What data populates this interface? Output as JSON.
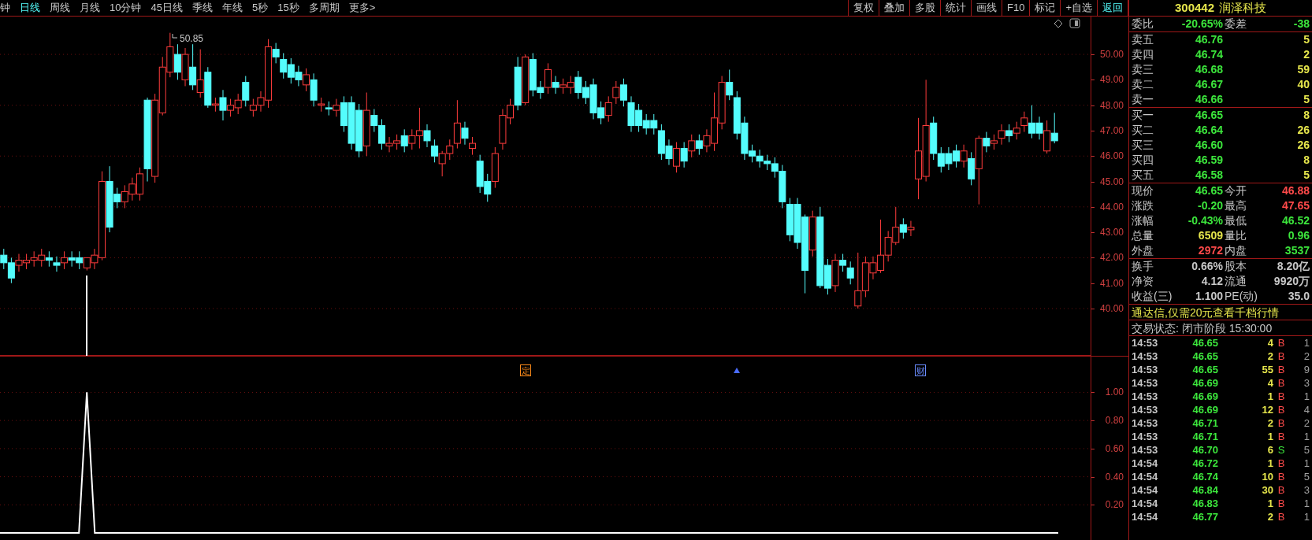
{
  "period_tabs": [
    {
      "label": "钟",
      "selected": false
    },
    {
      "label": "日线",
      "selected": true
    },
    {
      "label": "周线",
      "selected": false
    },
    {
      "label": "月线",
      "selected": false
    },
    {
      "label": "10分钟",
      "selected": false
    },
    {
      "label": "45日线",
      "selected": false
    },
    {
      "label": "季线",
      "selected": false
    },
    {
      "label": "年线",
      "selected": false
    },
    {
      "label": "5秒",
      "selected": false
    },
    {
      "label": "15秒",
      "selected": false
    },
    {
      "label": "多周期",
      "selected": false
    },
    {
      "label": "更多>",
      "selected": false
    }
  ],
  "toolbar": [
    {
      "label": "复权",
      "selected": false
    },
    {
      "label": "叠加",
      "selected": false
    },
    {
      "label": "多股",
      "selected": false
    },
    {
      "label": "统计",
      "selected": false
    },
    {
      "label": "画线",
      "selected": false
    },
    {
      "label": "F10",
      "selected": false
    },
    {
      "label": "标记",
      "selected": false
    },
    {
      "label": "+自选",
      "selected": false
    },
    {
      "label": "返回",
      "selected": true
    }
  ],
  "price_chart": {
    "high_label": "50.85",
    "chart_data": {
      "type": "candlestick",
      "grid": true,
      "ylim": [
        38.14,
        51.49
      ],
      "yticks": [
        {
          "value": 50,
          "label": "50.00"
        },
        {
          "value": 49,
          "label": "49.00"
        },
        {
          "value": 48,
          "label": "48.00"
        },
        {
          "value": 47,
          "label": "47.00"
        },
        {
          "value": 46,
          "label": "46.00"
        },
        {
          "value": 45,
          "label": "45.00"
        },
        {
          "value": 44,
          "label": "44.00"
        },
        {
          "value": 43,
          "label": "43.00"
        },
        {
          "value": 42,
          "label": "42.00"
        },
        {
          "value": 41,
          "label": "41.00"
        },
        {
          "value": 40,
          "label": "40.00"
        }
      ],
      "categories": [
        null,
        null,
        null,
        null,
        null,
        null,
        null,
        null,
        null,
        null,
        null,
        null,
        null,
        null,
        null,
        null,
        null,
        null,
        null,
        null,
        null,
        null,
        null,
        null,
        null,
        null,
        null,
        null,
        null,
        null,
        null,
        null,
        null,
        null,
        null,
        null,
        null,
        null,
        null,
        null,
        null,
        null,
        null,
        null,
        null,
        null,
        null,
        null,
        null,
        null,
        null,
        null,
        null,
        null,
        null,
        null,
        null,
        null,
        null,
        null,
        null,
        null,
        null,
        null,
        null,
        null,
        null,
        null,
        null,
        null,
        null,
        null,
        null,
        null,
        null,
        null,
        null,
        null,
        null,
        null,
        null,
        null,
        null,
        null,
        null,
        null,
        null,
        null,
        null,
        null,
        null,
        null,
        null,
        null,
        null,
        null,
        null,
        null,
        null,
        null,
        null,
        null,
        null,
        null,
        null,
        null,
        null,
        null,
        null,
        null,
        null,
        null,
        null,
        null,
        null,
        null,
        null,
        null,
        null,
        null,
        null,
        null,
        null,
        null,
        null,
        null,
        null,
        null,
        null,
        null,
        null,
        null,
        null,
        null,
        null,
        null,
        null,
        null,
        null,
        null
      ],
      "ohlc": [
        [
          42.1,
          42.35,
          41.55,
          41.8
        ],
        [
          41.8,
          42,
          41,
          41.2
        ],
        [
          41.7,
          42.15,
          41.45,
          41.9
        ],
        [
          41.8,
          42.15,
          41.55,
          41.9
        ],
        [
          41.9,
          42.25,
          41.65,
          42
        ],
        [
          41.9,
          42.35,
          41.65,
          42.1
        ],
        [
          42,
          42.25,
          41.65,
          41.9
        ],
        [
          41.8,
          42.05,
          41.45,
          41.7
        ],
        [
          41.8,
          42.25,
          41.55,
          42
        ],
        [
          42,
          42.25,
          41.65,
          41.9
        ],
        [
          42,
          42.25,
          41.55,
          41.8
        ],
        [
          41.6,
          42,
          41.5,
          42
        ],
        [
          41.8,
          42.35,
          41.55,
          42.1
        ],
        [
          42,
          45.4,
          41.9,
          45
        ],
        [
          45,
          45.6,
          43,
          43.2
        ],
        [
          44.5,
          44.75,
          43.95,
          44.2
        ],
        [
          44.2,
          44.85,
          43.95,
          44.6
        ],
        [
          44.5,
          45.15,
          44.25,
          44.9
        ],
        [
          44.5,
          45.55,
          44.25,
          45.3
        ],
        [
          48.2,
          48.3,
          45,
          45.5
        ],
        [
          45.2,
          48.45,
          44.95,
          48.2
        ],
        [
          47.7,
          49.9,
          47.6,
          49.5
        ],
        [
          49.3,
          50.85,
          49.1,
          50.3
        ],
        [
          50,
          50.4,
          49,
          49.3
        ],
        [
          49,
          50.25,
          48.75,
          50
        ],
        [
          49.5,
          50.4,
          48.6,
          48.8
        ],
        [
          48.5,
          50.2,
          48.3,
          49
        ],
        [
          49.3,
          49.5,
          47.9,
          48
        ],
        [
          48,
          48.3,
          47.75,
          48.05
        ],
        [
          48.3,
          48.6,
          47.4,
          47.8
        ],
        [
          47.8,
          48.25,
          47.55,
          48
        ],
        [
          47.9,
          48.45,
          47.65,
          48.2
        ],
        [
          48.9,
          49.15,
          47.95,
          48.2
        ],
        [
          47.8,
          48.25,
          47.55,
          48
        ],
        [
          48,
          48.55,
          47.75,
          48.3
        ],
        [
          48.2,
          50.6,
          47.9,
          50.3
        ],
        [
          50.2,
          50.45,
          49.65,
          49.9
        ],
        [
          49.8,
          50.05,
          49.05,
          49.3
        ],
        [
          49.6,
          49.85,
          48.85,
          49.1
        ],
        [
          49.3,
          49.55,
          48.75,
          49
        ],
        [
          48.8,
          49.45,
          48.55,
          49.2
        ],
        [
          49,
          49.25,
          47.95,
          48.2
        ],
        [
          48,
          48.3,
          47.75,
          48.05
        ],
        [
          47.9,
          48.15,
          47.6,
          47.85
        ],
        [
          47.8,
          48.25,
          47.55,
          48
        ],
        [
          48.1,
          48.35,
          46.95,
          47.2
        ],
        [
          48.1,
          48.35,
          46.25,
          46.5
        ],
        [
          47.8,
          48.05,
          45.95,
          46.2
        ],
        [
          46.4,
          48.5,
          46,
          47.8
        ],
        [
          47.6,
          47.85,
          46.95,
          47.2
        ],
        [
          47.2,
          47.45,
          46.25,
          46.5
        ],
        [
          46.4,
          46.75,
          46.15,
          46.5
        ],
        [
          46.5,
          46.85,
          46.25,
          46.6
        ],
        [
          46.8,
          47.05,
          46.15,
          46.4
        ],
        [
          46.5,
          47.05,
          46.25,
          46.8
        ],
        [
          46.8,
          47.9,
          46.3,
          47
        ],
        [
          47,
          47.25,
          46.35,
          46.6
        ],
        [
          46.4,
          46.65,
          45.75,
          46
        ],
        [
          45.7,
          46.2,
          45.2,
          46.1
        ],
        [
          46.1,
          46.65,
          45.85,
          46.4
        ],
        [
          46.5,
          48.2,
          46.3,
          47.3
        ],
        [
          47.1,
          47.35,
          46.45,
          46.7
        ],
        [
          46.3,
          46.75,
          46.05,
          46.5
        ],
        [
          45.8,
          46.05,
          44.55,
          44.8
        ],
        [
          45,
          45.3,
          44.2,
          44.5
        ],
        [
          45,
          46.35,
          44.75,
          46.1
        ],
        [
          46.5,
          47.85,
          46.25,
          47.6
        ],
        [
          47.5,
          48.25,
          47.25,
          48
        ],
        [
          49.5,
          49.9,
          47.8,
          48
        ],
        [
          48.1,
          50,
          48,
          49.9
        ],
        [
          49.8,
          50.05,
          48.35,
          48.6
        ],
        [
          48.7,
          48.95,
          48.25,
          48.5
        ],
        [
          48.7,
          49.65,
          48.45,
          49.4
        ],
        [
          48.9,
          49.15,
          48.45,
          48.7
        ],
        [
          48.7,
          49.05,
          48.45,
          48.8
        ],
        [
          48.7,
          49.15,
          48.45,
          48.9
        ],
        [
          49.1,
          49.35,
          48.25,
          48.5
        ],
        [
          48.7,
          48.95,
          48.05,
          48.3
        ],
        [
          48.8,
          49.05,
          47.45,
          47.7
        ],
        [
          47.9,
          48.15,
          47.25,
          47.5
        ],
        [
          47.6,
          48.35,
          47.35,
          48.1
        ],
        [
          48.3,
          48.95,
          48.05,
          48.7
        ],
        [
          48.8,
          49.05,
          47.95,
          48.2
        ],
        [
          48.1,
          48.35,
          46.95,
          47.2
        ],
        [
          47.8,
          48.05,
          46.95,
          47.2
        ],
        [
          47.4,
          47.65,
          46.85,
          47.1
        ],
        [
          47.4,
          47.65,
          46.85,
          47.1
        ],
        [
          47,
          47.25,
          45.85,
          46.1
        ],
        [
          46.4,
          46.65,
          45.65,
          45.9
        ],
        [
          45.6,
          46.55,
          45.35,
          46.3
        ],
        [
          46.3,
          46.55,
          45.55,
          45.8
        ],
        [
          46.2,
          46.85,
          45.95,
          46.6
        ],
        [
          46.6,
          46.85,
          46.05,
          46.3
        ],
        [
          46.4,
          47.05,
          46.15,
          46.8
        ],
        [
          46.5,
          48.5,
          46.2,
          47.5
        ],
        [
          47.3,
          49.15,
          47.05,
          48.9
        ],
        [
          48.9,
          49.4,
          48.2,
          48.4
        ],
        [
          48.3,
          48.55,
          46.65,
          46.9
        ],
        [
          47.3,
          47.55,
          45.85,
          46.1
        ],
        [
          46.2,
          46.45,
          45.75,
          46
        ],
        [
          46,
          46.25,
          45.55,
          45.8
        ],
        [
          45.8,
          46.05,
          45.45,
          45.7
        ],
        [
          45.7,
          45.95,
          45.15,
          45.4
        ],
        [
          45.4,
          45.65,
          43.95,
          44.2
        ],
        [
          44.1,
          44.35,
          42.65,
          42.9
        ],
        [
          44.1,
          44.35,
          42.35,
          42.6
        ],
        [
          43.6,
          43.7,
          40.6,
          41.5
        ],
        [
          42.3,
          43.85,
          42.05,
          43.6
        ],
        [
          43.6,
          44,
          40.8,
          40.9
        ],
        [
          41.7,
          41.95,
          40.55,
          40.8
        ],
        [
          40.9,
          42.15,
          40.65,
          41.9
        ],
        [
          41.9,
          42.15,
          41.45,
          41.7
        ],
        [
          41.6,
          41.85,
          40.95,
          41.2
        ],
        [
          40.1,
          42.2,
          40,
          40.7
        ],
        [
          40.7,
          42.05,
          40.45,
          41.8
        ],
        [
          41.4,
          42.05,
          41.15,
          41.8
        ],
        [
          41.5,
          43.5,
          41.4,
          42.1
        ],
        [
          42.1,
          43.05,
          41.85,
          42.8
        ],
        [
          42.6,
          44,
          42.5,
          43.2
        ],
        [
          43.3,
          43.55,
          42.75,
          43
        ],
        [
          43.1,
          43.45,
          42.85,
          43.2
        ],
        [
          45.1,
          47.5,
          44.3,
          46.2
        ],
        [
          45.2,
          49,
          45,
          47.2
        ],
        [
          47.3,
          47.55,
          45.85,
          46.1
        ],
        [
          46.1,
          46.35,
          45.35,
          45.6
        ],
        [
          46.1,
          46.35,
          45.45,
          45.7
        ],
        [
          46.2,
          46.45,
          45.55,
          45.8
        ],
        [
          45.8,
          46.45,
          45.55,
          46.2
        ],
        [
          45.9,
          46.15,
          44.85,
          45.1
        ],
        [
          45.5,
          46.8,
          44.1,
          46.7
        ],
        [
          46.7,
          46.95,
          46.15,
          46.4
        ],
        [
          46.5,
          46.85,
          46.25,
          46.6
        ],
        [
          46.7,
          47.25,
          46.45,
          47
        ],
        [
          47,
          47.25,
          46.55,
          46.8
        ],
        [
          46.9,
          47.35,
          46.65,
          47.1
        ],
        [
          47.2,
          47.75,
          46.95,
          47.5
        ],
        [
          47.3,
          48,
          46.7,
          46.9
        ],
        [
          47.3,
          47.55,
          46.65,
          46.9
        ],
        [
          46.2,
          47.4,
          46.1,
          47
        ],
        [
          46.9,
          47.7,
          46.5,
          46.6
        ]
      ]
    }
  },
  "indicator_chart": {
    "events": [
      {
        "kind": "badge",
        "label": "定",
        "color": "#ff8c1a"
      },
      {
        "kind": "arrow",
        "color": "#4a6cff"
      },
      {
        "kind": "badge",
        "label": "财",
        "color": "#6a8cff"
      }
    ],
    "chart_data": {
      "type": "line",
      "grid": true,
      "ylim": [
        -0.05,
        1.26
      ],
      "yticks": [
        {
          "value": 0.2,
          "label": "0.20"
        },
        {
          "value": 0.4,
          "label": "0.40"
        },
        {
          "value": 0.6,
          "label": "0.60"
        },
        {
          "value": 0.8,
          "label": "0.80"
        },
        {
          "value": 1.0,
          "label": "1.00"
        }
      ],
      "series": [
        {
          "color": "#ffffff",
          "values": [
            0,
            0,
            0,
            0,
            0,
            0,
            0,
            0,
            0,
            0,
            0,
            1,
            0,
            0,
            0,
            0,
            0,
            0,
            0,
            0,
            0,
            0,
            0,
            0,
            0,
            0,
            0,
            0,
            0,
            0,
            0,
            0,
            0,
            0,
            0,
            0,
            0,
            0,
            0,
            0,
            0,
            0,
            0,
            0,
            0,
            0,
            0,
            0,
            0,
            0,
            0,
            0,
            0,
            0,
            0,
            0,
            0,
            0,
            0,
            0,
            0,
            0,
            0,
            0,
            0,
            0,
            0,
            0,
            0,
            0,
            0,
            0,
            0,
            0,
            0,
            0,
            0,
            0,
            0,
            0,
            0,
            0,
            0,
            0,
            0,
            0,
            0,
            0,
            0,
            0,
            0,
            0,
            0,
            0,
            0,
            0,
            0,
            0,
            0,
            0,
            0,
            0,
            0,
            0,
            0,
            0,
            0,
            0,
            0,
            0,
            0,
            0,
            0,
            0,
            0,
            0,
            0,
            0,
            0,
            0,
            0,
            0,
            0,
            0,
            0,
            0,
            0,
            0,
            0,
            0,
            0,
            0,
            0,
            0,
            0
          ]
        }
      ]
    }
  },
  "quote": {
    "code": "300442",
    "name": "润泽科技",
    "ratio": [
      {
        "label": "委比",
        "value": "-20.65%",
        "color": "#3ce63c"
      },
      {
        "label": "委差",
        "value": "-38",
        "color": "#3ce63c"
      }
    ],
    "asks": [
      {
        "label": "卖五",
        "price": "46.76",
        "volume": "5"
      },
      {
        "label": "卖四",
        "price": "46.74",
        "volume": "2"
      },
      {
        "label": "卖三",
        "price": "46.68",
        "volume": "59"
      },
      {
        "label": "卖二",
        "price": "46.67",
        "volume": "40"
      },
      {
        "label": "卖一",
        "price": "46.66",
        "volume": "5"
      }
    ],
    "bids": [
      {
        "label": "买一",
        "price": "46.65",
        "volume": "8"
      },
      {
        "label": "买二",
        "price": "46.64",
        "volume": "26"
      },
      {
        "label": "买三",
        "price": "46.60",
        "volume": "26"
      },
      {
        "label": "买四",
        "price": "46.59",
        "volume": "8"
      },
      {
        "label": "买五",
        "price": "46.58",
        "volume": "5"
      }
    ],
    "stats": [
      {
        "label": "现价",
        "value": "46.65",
        "color": "#3ce63c"
      },
      {
        "label": "今开",
        "value": "46.88",
        "color": "#ff4a4a"
      },
      {
        "label": "涨跌",
        "value": "-0.20",
        "color": "#3ce63c"
      },
      {
        "label": "最高",
        "value": "47.65",
        "color": "#ff4a4a"
      },
      {
        "label": "涨幅",
        "value": "-0.43%",
        "color": "#3ce63c"
      },
      {
        "label": "最低",
        "value": "46.52",
        "color": "#3ce63c"
      },
      {
        "label": "总量",
        "value": "6509",
        "color": "#e6e64c"
      },
      {
        "label": "量比",
        "value": "0.96",
        "color": "#3ce63c"
      },
      {
        "label": "外盘",
        "value": "2972",
        "color": "#ff4a4a"
      },
      {
        "label": "内盘",
        "value": "3537",
        "color": "#3ce63c"
      }
    ],
    "fundamentals": [
      {
        "label": "换手",
        "value": "0.66%"
      },
      {
        "label": "股本",
        "value": "8.20亿"
      },
      {
        "label": "净资",
        "value": "4.12"
      },
      {
        "label": "流通",
        "value": "9920万"
      },
      {
        "label": "收益(三)",
        "value": "1.100"
      },
      {
        "label": "PE(动)",
        "value": "35.0"
      }
    ],
    "promo": "通达信,仅需20元查看千档行情",
    "trade_status": "交易状态: 闭市阶段 15:30:00",
    "ticks": [
      {
        "time": "14:53",
        "price": "46.65",
        "volume": "4",
        "side": "B",
        "color": "#ff4a4a",
        "count": "1"
      },
      {
        "time": "14:53",
        "price": "46.65",
        "volume": "2",
        "side": "B",
        "color": "#ff4a4a",
        "count": "2"
      },
      {
        "time": "14:53",
        "price": "46.65",
        "volume": "55",
        "side": "B",
        "color": "#ff4a4a",
        "count": "9"
      },
      {
        "time": "14:53",
        "price": "46.69",
        "volume": "4",
        "side": "B",
        "color": "#ff4a4a",
        "count": "3"
      },
      {
        "time": "14:53",
        "price": "46.69",
        "volume": "1",
        "side": "B",
        "color": "#ff4a4a",
        "count": "1"
      },
      {
        "time": "14:53",
        "price": "46.69",
        "volume": "12",
        "side": "B",
        "color": "#ff4a4a",
        "count": "4"
      },
      {
        "time": "14:53",
        "price": "46.71",
        "volume": "2",
        "side": "B",
        "color": "#ff4a4a",
        "count": "2"
      },
      {
        "time": "14:53",
        "price": "46.71",
        "volume": "1",
        "side": "B",
        "color": "#ff4a4a",
        "count": "1"
      },
      {
        "time": "14:53",
        "price": "46.70",
        "volume": "6",
        "side": "S",
        "color": "#3ce63c",
        "count": "5"
      },
      {
        "time": "14:54",
        "price": "46.72",
        "volume": "1",
        "side": "B",
        "color": "#ff4a4a",
        "count": "1"
      },
      {
        "time": "14:54",
        "price": "46.74",
        "volume": "10",
        "side": "B",
        "color": "#ff4a4a",
        "count": "5"
      },
      {
        "time": "14:54",
        "price": "46.84",
        "volume": "30",
        "side": "B",
        "color": "#ff4a4a",
        "count": "3"
      },
      {
        "time": "14:54",
        "price": "46.83",
        "volume": "1",
        "side": "B",
        "color": "#ff4a4a",
        "count": "1"
      },
      {
        "time": "14:54",
        "price": "46.77",
        "volume": "2",
        "side": "B",
        "color": "#ff4a4a",
        "count": "1"
      }
    ]
  }
}
